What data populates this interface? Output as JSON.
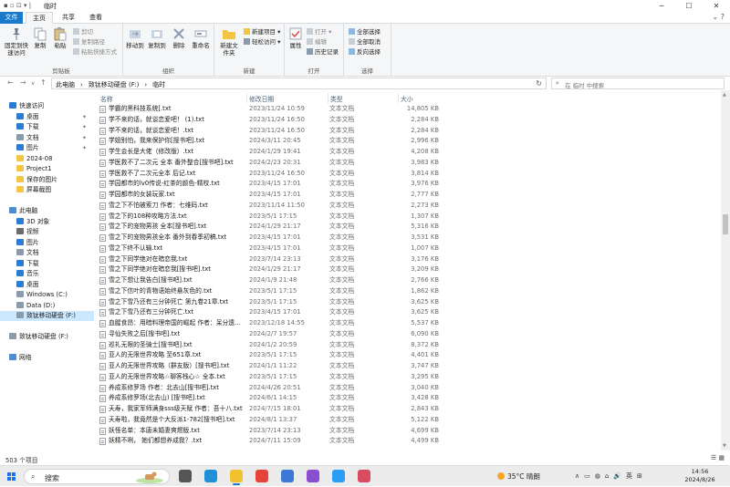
{
  "window": {
    "title": "临时",
    "quick_access": "▪ ▫ ⊡ ▾ |"
  },
  "tabs": {
    "file": "文件",
    "home": "主页",
    "share": "共享",
    "view": "查看"
  },
  "ribbon": {
    "clipboard": {
      "pin": "固定到快速访问",
      "copy": "复制",
      "paste": "粘贴",
      "cut": "剪切",
      "copy_path": "复制路径",
      "paste_shortcut": "粘贴快捷方式",
      "label": "剪贴板"
    },
    "organize": {
      "move_to": "移动到",
      "copy_to": "复制到",
      "delete": "删除",
      "rename": "重命名",
      "label": "组织"
    },
    "new": {
      "new_folder": "新建文件夹",
      "new_item": "新建项目 ▾",
      "easy_access": "轻松访问 ▾",
      "label": "新建"
    },
    "open": {
      "properties": "属性",
      "open": "打开 ▾",
      "edit": "编辑",
      "history": "历史记录",
      "label": "打开"
    },
    "select": {
      "select_all": "全部选择",
      "select_none": "全部取消",
      "invert": "反向选择",
      "label": "选择"
    }
  },
  "address": {
    "crumbs": [
      "此电脑",
      "›",
      "致钛移动硬盘 (F:)",
      "›",
      "临时"
    ],
    "search_placeholder": "在 临时 中搜索"
  },
  "nav": {
    "items": [
      {
        "label": "快速访问",
        "icon": "star-icon",
        "color": "#2b7cd3",
        "pinned": false,
        "indent": 0
      },
      {
        "label": "桌面",
        "icon": "desktop-icon",
        "color": "#2b7cd3",
        "pinned": true,
        "indent": 1
      },
      {
        "label": "下载",
        "icon": "download-icon",
        "color": "#2b7cd3",
        "pinned": true,
        "indent": 1
      },
      {
        "label": "文档",
        "icon": "document-icon",
        "color": "#8a9bb0",
        "pinned": true,
        "indent": 1
      },
      {
        "label": "图片",
        "icon": "picture-icon",
        "color": "#2b7cd3",
        "pinned": true,
        "indent": 1
      },
      {
        "label": "2024-08",
        "icon": "folder-icon",
        "color": "#f4c542",
        "pinned": false,
        "indent": 1
      },
      {
        "label": "Project1",
        "icon": "folder-icon",
        "color": "#f4c542",
        "pinned": false,
        "indent": 1
      },
      {
        "label": "保存的图片",
        "icon": "folder-icon",
        "color": "#f4c542",
        "pinned": false,
        "indent": 1
      },
      {
        "label": "屏幕截图",
        "icon": "folder-icon",
        "color": "#f4c542",
        "pinned": false,
        "indent": 1
      },
      {
        "label": "",
        "icon": "",
        "color": "",
        "pinned": false,
        "indent": 0
      },
      {
        "label": "此电脑",
        "icon": "computer-icon",
        "color": "#4a8fd6",
        "pinned": false,
        "indent": 0
      },
      {
        "label": "3D 对象",
        "icon": "3d-objects-icon",
        "color": "#2b7cd3",
        "pinned": false,
        "indent": 1
      },
      {
        "label": "视频",
        "icon": "video-icon",
        "color": "#6b6b6b",
        "pinned": false,
        "indent": 1
      },
      {
        "label": "图片",
        "icon": "picture-icon",
        "color": "#2b7cd3",
        "pinned": false,
        "indent": 1
      },
      {
        "label": "文档",
        "icon": "document-icon",
        "color": "#8a9bb0",
        "pinned": false,
        "indent": 1
      },
      {
        "label": "下载",
        "icon": "download-icon",
        "color": "#2b7cd3",
        "pinned": false,
        "indent": 1
      },
      {
        "label": "音乐",
        "icon": "music-icon",
        "color": "#2b7cd3",
        "pinned": false,
        "indent": 1
      },
      {
        "label": "桌面",
        "icon": "desktop-icon",
        "color": "#2b7cd3",
        "pinned": false,
        "indent": 1
      },
      {
        "label": "Windows (C:)",
        "icon": "drive-icon",
        "color": "#8a9bb0",
        "pinned": false,
        "indent": 1
      },
      {
        "label": "Data (D:)",
        "icon": "drive-icon",
        "color": "#8a9bb0",
        "pinned": false,
        "indent": 1
      },
      {
        "label": "致钛移动硬盘 (F:)",
        "icon": "drive-icon",
        "color": "#8a9bb0",
        "pinned": false,
        "indent": 1,
        "selected": true
      },
      {
        "label": "",
        "icon": "",
        "color": "",
        "pinned": false,
        "indent": 0
      },
      {
        "label": "致钛移动硬盘 (F:)",
        "icon": "drive-icon",
        "color": "#8a9bb0",
        "pinned": false,
        "indent": 0
      },
      {
        "label": "",
        "icon": "",
        "color": "",
        "pinned": false,
        "indent": 0
      },
      {
        "label": "网络",
        "icon": "network-icon",
        "color": "#4a8fd6",
        "pinned": false,
        "indent": 0
      }
    ]
  },
  "columns": {
    "name": "名称",
    "date": "修改日期",
    "type": "类型",
    "size": "大小"
  },
  "files": [
    {
      "name": "学霸的黑科技系统[.txt",
      "date": "2023/11/24 10:59",
      "type": "文本文档",
      "size": "14,805 KB"
    },
    {
      "name": "学不来的话，就谈恋爱吧！ (1).txt",
      "date": "2023/11/24 16:50",
      "type": "文本文档",
      "size": "2,284 KB"
    },
    {
      "name": "学不来的话，就谈恋爱吧！.txt",
      "date": "2023/11/24 16:50",
      "type": "文本文档",
      "size": "2,284 KB"
    },
    {
      "name": "学姐别怕，我来保护你[搜书吧].txt",
      "date": "2024/3/11 20:45",
      "type": "文本文档",
      "size": "2,996 KB"
    },
    {
      "name": "学生会长是大佬（修改版）.txt",
      "date": "2024/1/29 19:41",
      "type": "文本文档",
      "size": "4,208 KB"
    },
    {
      "name": "学医救不了二次元 全本 番外整合[搜书吧].txt",
      "date": "2024/2/23 20:31",
      "type": "文本文档",
      "size": "3,983 KB"
    },
    {
      "name": "学医救不了二次元全本 后记.txt",
      "date": "2023/11/24 16:50",
      "type": "文本文档",
      "size": "3,814 KB"
    },
    {
      "name": "学园都市的lv0传说-红茶的颜色-精校.txt",
      "date": "2023/4/15 17:01",
      "type": "文本文档",
      "size": "3,976 KB"
    },
    {
      "name": "学园都市的女装玩家.txt",
      "date": "2023/4/15 17:01",
      "type": "文本文档",
      "size": "2,777 KB"
    },
    {
      "name": "雪之下不怕被索刀 作者：七维码.txt",
      "date": "2023/11/14 11:50",
      "type": "文本文档",
      "size": "2,273 KB"
    },
    {
      "name": "雪之下的108种攻略方法.txt",
      "date": "2023/5/1 17:15",
      "type": "文本文档",
      "size": "1,307 KB"
    },
    {
      "name": "雪之下的宠物男孩 全本[搜书吧].txt",
      "date": "2024/1/29 21:17",
      "type": "文本文档",
      "size": "5,316 KB"
    },
    {
      "name": "雪之下的宠物男孩全本 番外到春季初稿.txt",
      "date": "2023/4/15 17:01",
      "type": "文本文档",
      "size": "3,531 KB"
    },
    {
      "name": "雪之下终不认输.txt",
      "date": "2023/4/15 17:01",
      "type": "文本文档",
      "size": "1,007 KB"
    },
    {
      "name": "雪之下同学绝对在暗恋我.txt",
      "date": "2023/7/14 23:13",
      "type": "文本文档",
      "size": "3,176 KB"
    },
    {
      "name": "雪之下同学绝对在暗恋我[搜书吧].txt",
      "date": "2024/1/29 21:17",
      "type": "文本文档",
      "size": "3,209 KB"
    },
    {
      "name": "雪之下想让我告白[搜书吧].txt",
      "date": "2024/1/9 21:48",
      "type": "文本文档",
      "size": "2,766 KB"
    },
    {
      "name": "雪之下信叶的青物语始终悬灰色的.txt",
      "date": "2023/5/1 17:15",
      "type": "文本文档",
      "size": "1,862 KB"
    },
    {
      "name": "雪之下雪乃还有三分钟死亡 第九卷21章.txt",
      "date": "2023/5/1 17:15",
      "type": "文本文档",
      "size": "3,625 KB"
    },
    {
      "name": "雪之下雪乃还有三分钟死亡.txt",
      "date": "2023/4/15 17:01",
      "type": "文本文档",
      "size": "3,625 KB"
    },
    {
      "name": "血腥食昂：用暗料理帝国的崛起 作者：呆分遗...",
      "date": "2023/12/18 14:55",
      "type": "文本文档",
      "size": "5,537 KB"
    },
    {
      "name": "寻仙失败之后[搜书吧].txt",
      "date": "2024/2/7 19:57",
      "type": "文本文档",
      "size": "6,090 KB"
    },
    {
      "name": "巡礼无限的圣骑士[搜书吧].txt",
      "date": "2024/1/2 20:59",
      "type": "文本文档",
      "size": "8,372 KB"
    },
    {
      "name": "亚人的无限世界攻略 至651章.txt",
      "date": "2023/5/1 17:15",
      "type": "文本文档",
      "size": "4,401 KB"
    },
    {
      "name": "亚人的无限世界攻略（群友版）[搜书吧].txt",
      "date": "2024/1/1 11:22",
      "type": "文本文档",
      "size": "3,747 KB"
    },
    {
      "name": "亚人的无限世界攻略☆聊客栈心☆ 全本.txt",
      "date": "2023/5/1 17:15",
      "type": "文本文档",
      "size": "3,295 KB"
    },
    {
      "name": "养成系修罗场 作者：北去山[搜书吧].txt",
      "date": "2024/4/26 20:51",
      "type": "文本文档",
      "size": "3,040 KB"
    },
    {
      "name": "养成系修罗场(北去山) [搜书吧].txt",
      "date": "2024/6/1 14:15",
      "type": "文本文档",
      "size": "3,428 KB"
    },
    {
      "name": "夭寿，我家军师满身sss级天赋 作者：吾十八.txt",
      "date": "2024/7/15 18:01",
      "type": "文本文档",
      "size": "2,843 KB"
    },
    {
      "name": "夭寿啦，我竟然是个大反派1-782[搜书吧].txt",
      "date": "2024/8/1 13:37",
      "type": "文本文档",
      "size": "5,122 KB"
    },
    {
      "name": "妖怪名单：本唐未婚妻爽燃版.txt",
      "date": "2023/7/14 23:13",
      "type": "文本文档",
      "size": "4,699 KB"
    },
    {
      "name": "妖精不咧， 她们都想养成我？.txt",
      "date": "2024/7/11 15:09",
      "type": "文本文档",
      "size": "4,499 KB"
    }
  ],
  "status": {
    "count": "503 个项目"
  },
  "taskbar": {
    "search_label": "搜索",
    "apps": [
      "task-view-icon",
      "edge-icon",
      "file-explorer-icon",
      "chrome-icon",
      "mail-icon",
      "visual-studio-icon",
      "feishu-icon",
      "photo-app-icon"
    ],
    "app_colors": [
      "#555555",
      "#1f8fd6",
      "#f2c12e",
      "#e6433b",
      "#3c79d6",
      "#8a4fd1",
      "#2a9df4",
      "#d94c5f"
    ],
    "weather": "35°C 晴朗",
    "tray": [
      "∧",
      "▭",
      "◍",
      "⌂",
      "🔊",
      "英",
      "⊞"
    ],
    "time": "14:56",
    "date": "2024/8/26"
  },
  "colors": {
    "accent": "#1979ca",
    "selected": "#cce8ff"
  }
}
